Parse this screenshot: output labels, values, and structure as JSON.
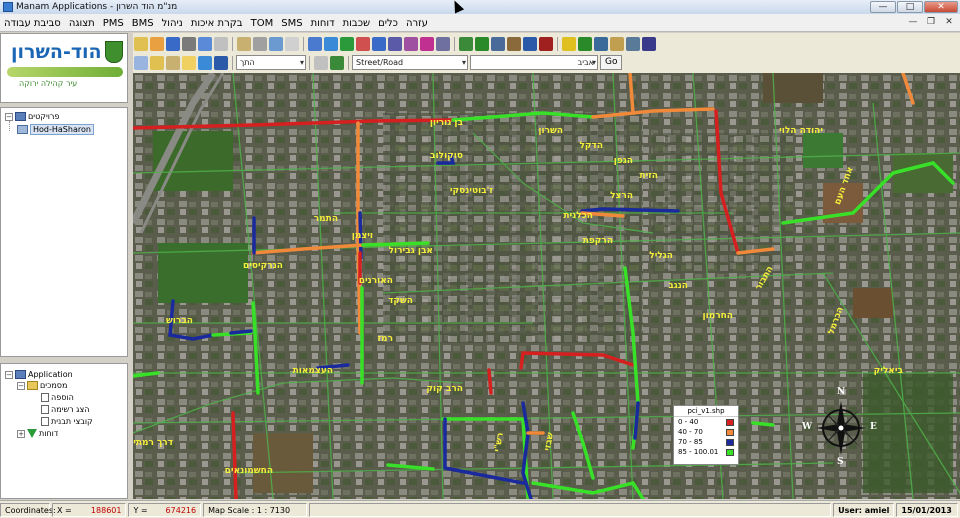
{
  "window": {
    "title": "Manam Applications - מנ\"מ הוד השרון",
    "minimize": "—",
    "maximize": "□",
    "close": "✕"
  },
  "menu": {
    "items": [
      "עזרה",
      "כלים",
      "שכבות",
      "דוחות",
      "SMS",
      "TOM",
      "בקרת איכות",
      "ניהול",
      "BMS",
      "PMS",
      "תצוגה",
      "סביבת עבודה"
    ],
    "mdi_minimize": "—",
    "mdi_restore": "❐",
    "mdi_close": "✕"
  },
  "logo": {
    "title": "הוד-השרון",
    "subtitle": "עיר קהילה ירוקה"
  },
  "tree": {
    "root": "פרויקטים",
    "child": "Hod-HaSharon"
  },
  "app_tree": {
    "root": "Application",
    "folder": "מסמכים",
    "items": [
      "הוספה",
      "הצג רשימה",
      "קובצי תבנית"
    ],
    "reports": "דוחות"
  },
  "toolbar": {
    "combo_to": "התך",
    "combo_street_type": "Street/Road",
    "combo_street_value": "אביב",
    "go_label": "Go",
    "layer_hint": "הוד"
  },
  "map": {
    "street_labels": [
      "בן גוריון",
      "השרון",
      "הדקל",
      "הגפן",
      "הזית",
      "הרצל",
      "סוקולוב",
      "ז'בוטינסקי",
      "ויצמן",
      "התמר",
      "הנרקיסים",
      "האורנים",
      "השקד",
      "הברוש",
      "רמז",
      "אבן גבירול",
      "הכלנית",
      "הרקפת",
      "הגליל",
      "הנגב",
      "החרמון",
      "התבור",
      "הכרמל",
      "יהודה הלוי",
      "אחד העם",
      "ביאליק",
      "שבזי",
      "רש\"י",
      "הרב קוק",
      "העצמאות",
      "דרך רמתיים",
      "החשמונאים"
    ],
    "compass": {
      "n": "N",
      "s": "S",
      "e": "E",
      "w": "W"
    }
  },
  "legend": {
    "title": "pci_v1.shp",
    "rows": [
      {
        "label": "0 - 40",
        "color": "#d62020"
      },
      {
        "label": "40 - 70",
        "color": "#f08a3a"
      },
      {
        "label": "70 - 85",
        "color": "#1a2a9c"
      },
      {
        "label": "85 - 100.01",
        "color": "#39e028"
      }
    ]
  },
  "chart_data": {
    "type": "map",
    "title": "pci_v1.shp",
    "legend": [
      {
        "range": [
          0,
          40
        ],
        "label": "0 - 40",
        "color": "#d62020"
      },
      {
        "range": [
          40,
          70
        ],
        "label": "40 - 70",
        "color": "#f08a3a"
      },
      {
        "range": [
          70,
          85
        ],
        "label": "70 - 85",
        "color": "#1a2a9c"
      },
      {
        "range": [
          85,
          100.01
        ],
        "label": "85 - 100.01",
        "color": "#39e028"
      }
    ]
  },
  "status": {
    "coordinates_label": "Coordinates:",
    "x_label": "X =",
    "x_value": "188601",
    "y_label": "Y =",
    "y_value": "674216",
    "scale_label": "Map Scale : 1 : 7130",
    "user_label": "User: amiel",
    "date": "15/01/2013"
  },
  "colors": {
    "pci_red": "#d62020",
    "pci_orange": "#f08a3a",
    "pci_blue": "#1a2a9c",
    "pci_green": "#39e028",
    "street_label": "#f5ee3a"
  }
}
